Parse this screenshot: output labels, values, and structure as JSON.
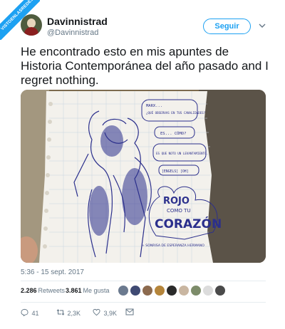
{
  "badge": {
    "text": "VISTOENLASREDES"
  },
  "user": {
    "display_name": "Davinnistrad",
    "handle": "@Davinnistrad",
    "avatar_icon": "avatar-illustration"
  },
  "header": {
    "follow_label": "Seguir",
    "menu_icon": "chevron-down-icon"
  },
  "tweet": {
    "text": "He encontrado esto en mis apuntes de Historia Contemporánea del año pasado and I regret nothing.",
    "timestamp": "5:36 - 15 sept. 2017"
  },
  "media": {
    "description_icon": "notebook-drawing-image",
    "bubbles": [
      "MARX...",
      "¿QUÉ OBSERVAS EN TUS CANALIDADES?",
      "ES... CÓMO?",
      "ES QUE NOTO UN LEVANTAMIENTO.",
      "[ENGELS] [OH]"
    ],
    "rojo": "ROJO",
    "como_tu": "COMO TU",
    "corazon": "CORAZÓN",
    "caption": "+ SONRISA DE ESPERANZA HERMANO"
  },
  "stats": {
    "retweets_count": "2.286",
    "retweets_label": "Retweets",
    "likes_count": "3.861",
    "likes_label": "Me gusta"
  },
  "likers": {
    "colors": [
      "#6b7a8f",
      "#3f4a73",
      "#8c6a4e",
      "#b5853b",
      "#2a2a2a",
      "#c9b6a1",
      "#7d8c6a",
      "#dcdcdc",
      "#4a4a4a"
    ]
  },
  "actions": {
    "reply_count": "41",
    "retweet_count": "2,3K",
    "like_count": "3,9K",
    "reply_icon": "reply-icon",
    "retweet_icon": "retweet-icon",
    "like_icon": "heart-icon",
    "dm_icon": "envelope-icon"
  },
  "colors": {
    "accent": "#1da1f2",
    "secondary_text": "#657786",
    "text": "#14171a"
  }
}
